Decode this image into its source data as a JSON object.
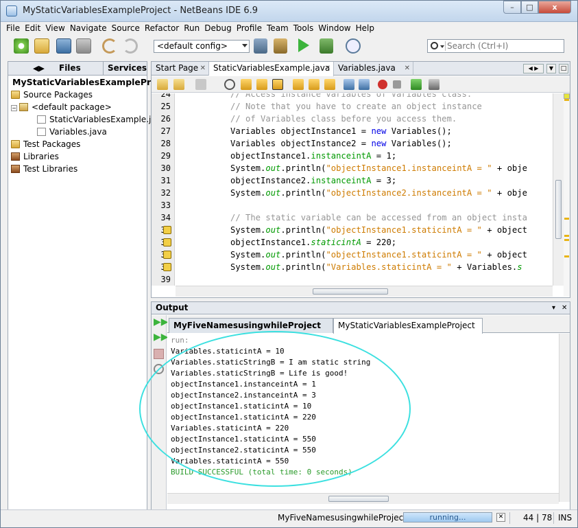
{
  "window": {
    "title": "MyStaticVariablesExampleProject - NetBeans IDE 6.9",
    "controls": {
      "minimize": "–",
      "maximize": "□",
      "close": "x"
    }
  },
  "menu": [
    "File",
    "Edit",
    "View",
    "Navigate",
    "Source",
    "Refactor",
    "Run",
    "Debug",
    "Profile",
    "Team",
    "Tools",
    "Window",
    "Help"
  ],
  "toolbar": {
    "config": "<default config>",
    "search_placeholder": "Search (Ctrl+I)"
  },
  "left_panel": {
    "tabs": [
      "Files",
      "Services"
    ],
    "project": "MyStaticVariablesExampleProject",
    "tree": [
      {
        "label": "Source Packages",
        "icon": "folder-icon"
      },
      {
        "label": "<default package>",
        "icon": "package-icon"
      },
      {
        "label": "StaticVariablesExample.java",
        "icon": "java-file-icon"
      },
      {
        "label": "Variables.java",
        "icon": "java-file-icon"
      },
      {
        "label": "Test Packages",
        "icon": "folder-icon"
      },
      {
        "label": "Libraries",
        "icon": "library-icon"
      },
      {
        "label": "Test Libraries",
        "icon": "library-icon"
      }
    ]
  },
  "editor": {
    "tabs": [
      "Start Page",
      "StaticVariablesExample.java",
      "Variables.java"
    ],
    "active_tab": "StaticVariablesExample.java",
    "line_numbers": [
      "24",
      "25",
      "26",
      "27",
      "28",
      "29",
      "30",
      "31",
      "32",
      "33",
      "34",
      "35",
      "36",
      "37",
      "38",
      "39"
    ],
    "code": {
      "l24": "// Access instance variables of Variables class.",
      "l25": "// Note that you have to create an object instance",
      "l26": "// of Variables class before you access them.",
      "l27a": "Variables objectInstance1 = ",
      "l27b": "new",
      "l27c": " Variables();",
      "l28a": "Variables objectInstance2 = ",
      "l28b": "new",
      "l28c": " Variables();",
      "l29a": "objectInstance1.",
      "l29b": "instanceintA",
      "l29c": " = 1;",
      "l30a": "System.",
      "l30b": "out",
      "l30c": ".println(",
      "l30d": "\"objectInstance1.instanceintA = \"",
      "l30e": " + obje",
      "l31a": "objectInstance2.",
      "l31b": "instanceintA",
      "l31c": " = 3;",
      "l32a": "System.",
      "l32b": "out",
      "l32c": ".println(",
      "l32d": "\"objectInstance2.instanceintA = \"",
      "l32e": " + obje",
      "l34": "// The static variable can be accessed from an object insta",
      "l35a": "System.",
      "l35b": "out",
      "l35c": ".println(",
      "l35d": "\"objectInstance1.staticintA = \"",
      "l35e": " + object",
      "l36a": "objectInstance1.",
      "l36b": "staticintA",
      "l36c": " = 220;",
      "l37a": "System.",
      "l37b": "out",
      "l37c": ".println(",
      "l37d": "\"objectInstance1.staticintA = \"",
      "l37e": " + object",
      "l38a": "System.",
      "l38b": "out",
      "l38c": ".println(",
      "l38d": "\"Variables.staticintA = \"",
      "l38e": " + Variables.",
      "l38f": "s"
    }
  },
  "output": {
    "title": "Output",
    "tabs": [
      "MyFiveNamesusingwhileProject (run)",
      "MyStaticVariablesExampleProject (run)"
    ],
    "lines": [
      "run:",
      "Variables.staticintA = 10",
      "Variables.staticStringB = I am static string",
      "Variables.staticStringB = Life is good!",
      "objectInstance1.instanceintA = 1",
      "objectInstance2.instanceintA = 3",
      "objectInstance1.staticintA = 10",
      "objectInstance1.staticintA = 220",
      "Variables.staticintA = 220",
      "objectInstance1.staticintA = 550",
      "objectInstance2.staticintA = 550",
      "Variables.staticintA = 550",
      "BUILD SUCCESSFUL (total time: 0 seconds)"
    ]
  },
  "status": {
    "project": "MyFiveNamesusingwhileProject (run)",
    "progress": "running...",
    "caret": "44 | 78",
    "mode": "INS"
  },
  "colors": {
    "accent": "#3ce0e0",
    "keyword": "#0000e6",
    "string": "#ce7b00",
    "field": "#009900",
    "comment": "#969696"
  }
}
